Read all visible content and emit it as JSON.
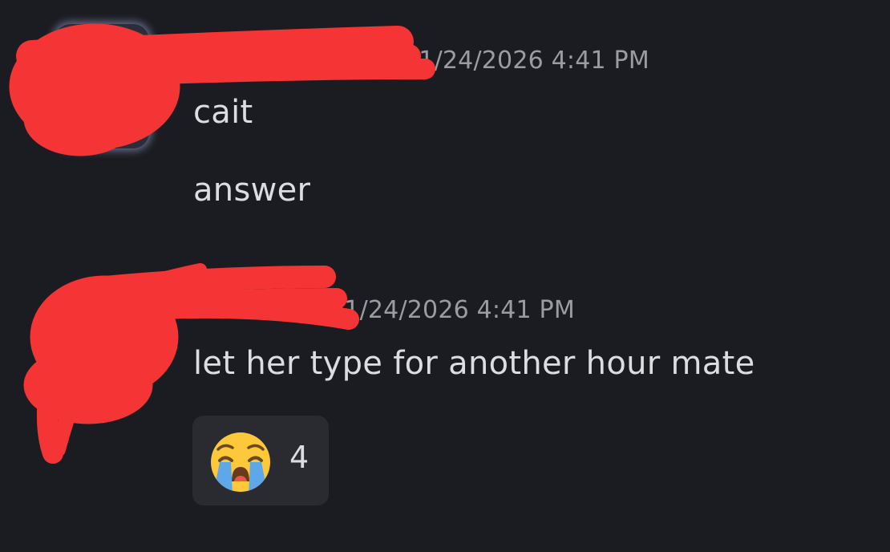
{
  "messages": [
    {
      "timestamp": "01/24/2026 4:41 PM",
      "lines": [
        "cait",
        "answer"
      ]
    },
    {
      "timestamp": "01/24/2026 4:41 PM",
      "lines": [
        "let her type for another hour mate"
      ],
      "reaction": {
        "emoji": "loudly-crying-face",
        "count": "4"
      }
    }
  ],
  "colors": {
    "background": "#1b1c21",
    "text": "#dcdde1",
    "timestamp": "#9b9ca3",
    "reaction_bg": "#2a2b31",
    "redaction": "#f53535"
  }
}
